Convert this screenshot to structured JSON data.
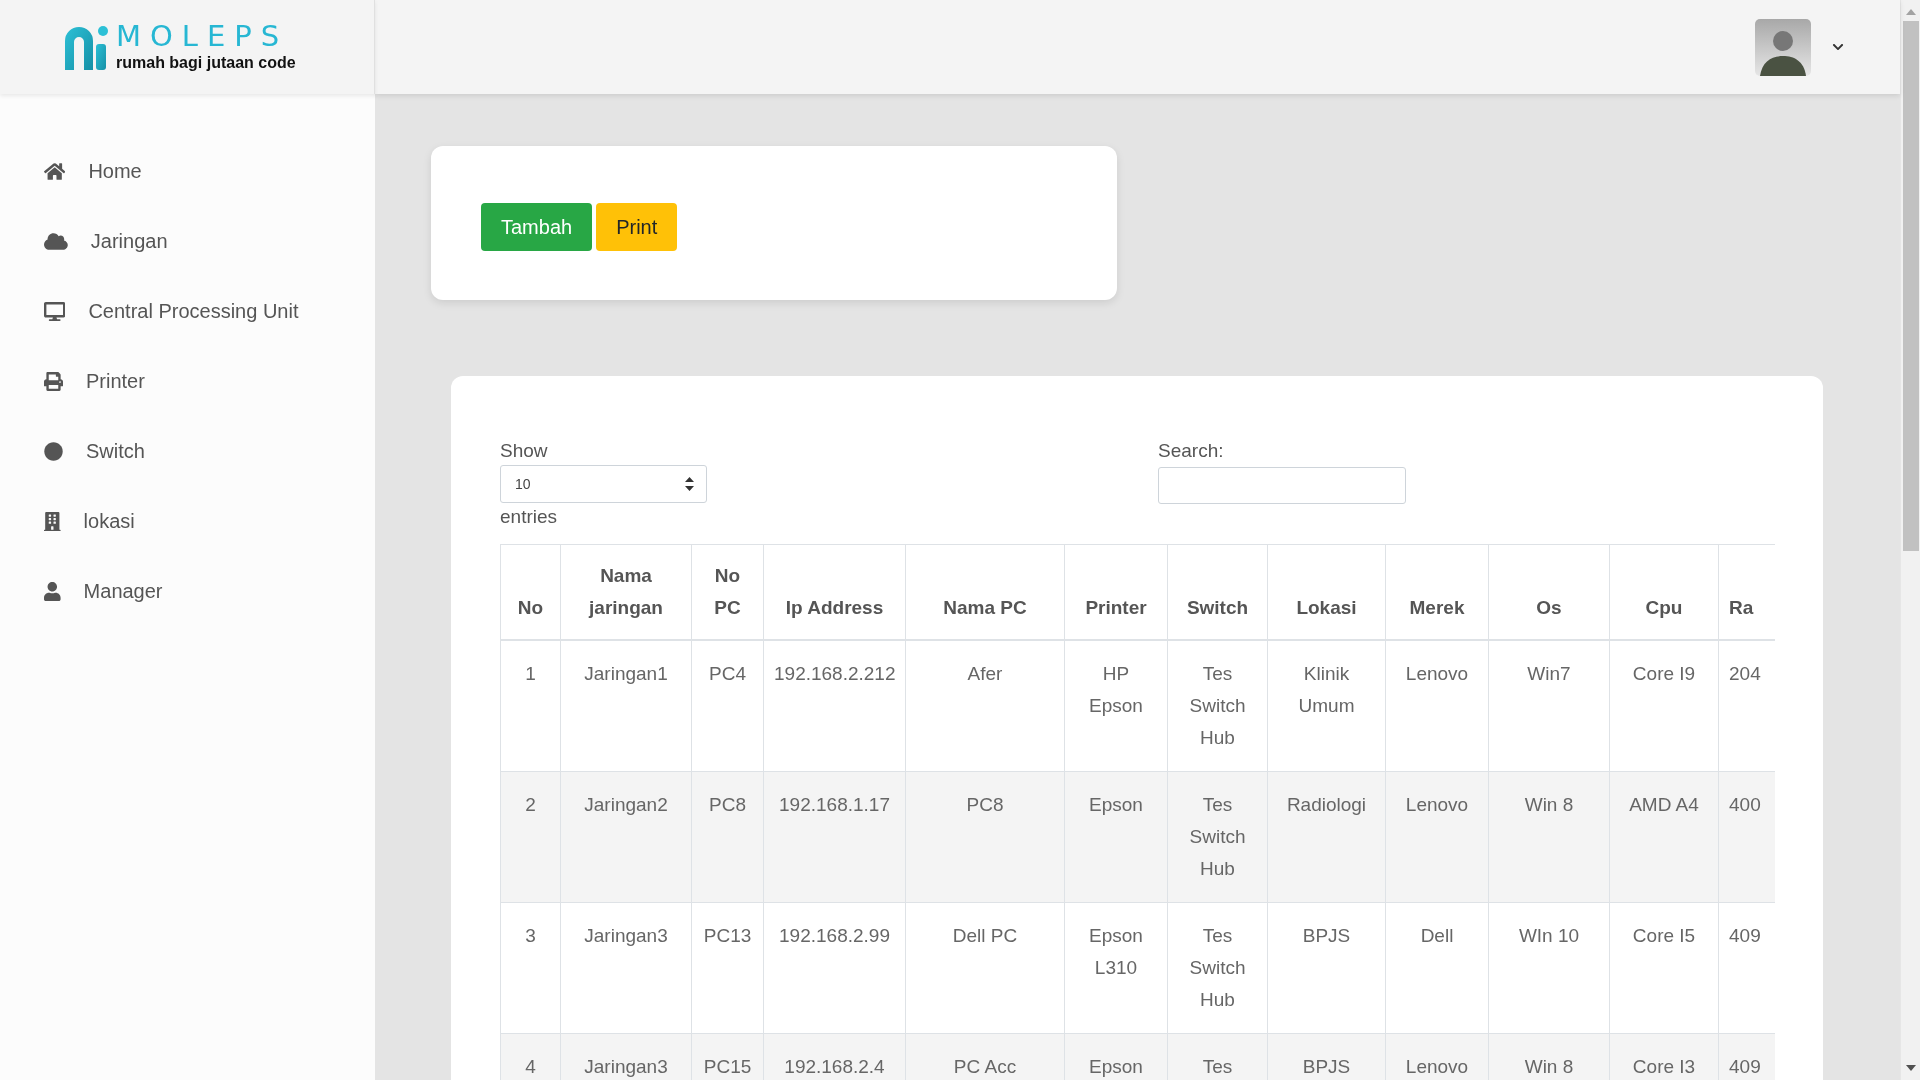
{
  "brand": {
    "name": "MOLEPS",
    "tagline": "rumah bagi jutaan code"
  },
  "sidebar": {
    "items": [
      {
        "label": "Home"
      },
      {
        "label": "Jaringan"
      },
      {
        "label": "Central Processing Unit"
      },
      {
        "label": "Printer"
      },
      {
        "label": "Switch"
      },
      {
        "label": "lokasi"
      },
      {
        "label": "Manager"
      }
    ]
  },
  "actions": [
    {
      "label": "Tambah",
      "kind": "success"
    },
    {
      "label": "Print",
      "kind": "warning"
    }
  ],
  "table_controls": {
    "show_label": "Show",
    "page_length": "10",
    "entries_label": "entries",
    "search_label": "Search:"
  },
  "table": {
    "columns": [
      "No",
      "Nama jaringan",
      "No PC",
      "Ip Address",
      "Nama PC",
      "Printer",
      "Switch",
      "Lokasi",
      "Merek",
      "Os",
      "Cpu",
      "Ra"
    ],
    "rows": [
      [
        "1",
        "Jaringan1",
        "PC4",
        "192.168.2.212",
        "Afer",
        "HP Epson",
        "Tes Switch Hub",
        "Klinik Umum",
        "Lenovo",
        "Win7",
        "Core I9",
        "204"
      ],
      [
        "2",
        "Jaringan2",
        "PC8",
        "192.168.1.17",
        "PC8",
        "Epson",
        "Tes Switch Hub",
        "Radiologi",
        "Lenovo",
        "Win 8",
        "AMD A4",
        "400"
      ],
      [
        "3",
        "Jaringan3",
        "PC13",
        "192.168.2.99",
        "Dell PC",
        "Epson L310",
        "Tes Switch Hub",
        "BPJS",
        "Dell",
        "WIn 10",
        "Core I5",
        "409"
      ],
      [
        "4",
        "Jaringan3",
        "PC15",
        "192.168.2.4",
        "PC Acc",
        "Epson",
        "Tes",
        "BPJS",
        "Lenovo",
        "Win 8",
        "Core I3",
        "409"
      ]
    ]
  }
}
